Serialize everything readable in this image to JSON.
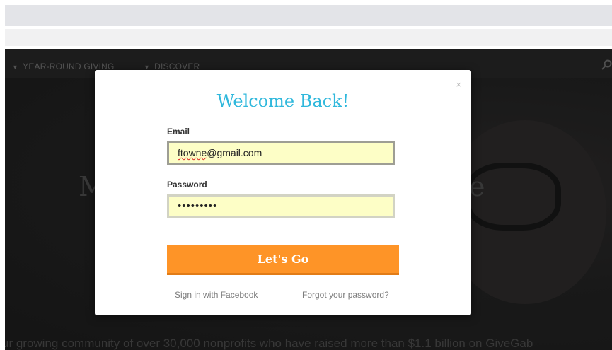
{
  "nav": {
    "items": [
      {
        "label": "YEAR-ROUND GIVING"
      },
      {
        "label": "DISCOVER"
      }
    ]
  },
  "hero": {
    "title_left": "M",
    "title_right": "e",
    "subtitle": "ur growing community of over 30,000 nonprofits who have raised more than $1.1 billion on GiveGab"
  },
  "modal": {
    "close_label": "×",
    "title": "Welcome Back!",
    "email_label": "Email",
    "email_user": "ftowne",
    "email_domain": "@gmail.com",
    "password_label": "Password",
    "password_mask": "•••••••••",
    "submit_label": "Let's Go",
    "facebook_link": "Sign in with Facebook",
    "forgot_link": "Forgot your password?"
  },
  "colors": {
    "accent": "#30b8dc",
    "button": "#fe9427",
    "autofill": "#fdfec6"
  }
}
